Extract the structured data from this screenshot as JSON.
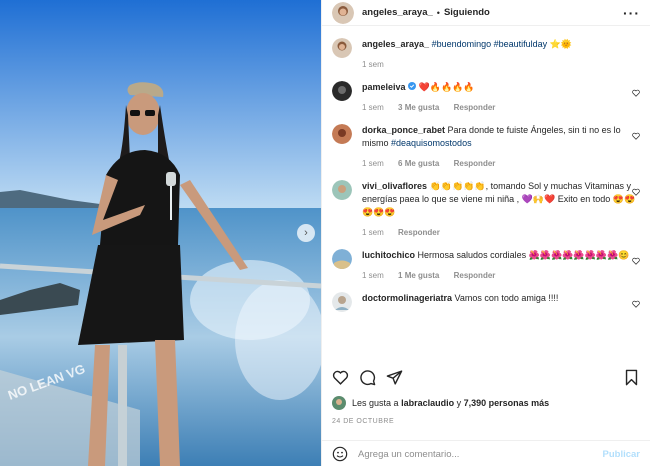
{
  "header": {
    "username": "angeles_araya_",
    "separator": "•",
    "follow_label": "Siguiendo",
    "more_icon": "more-icon"
  },
  "caption": {
    "username": "angeles_araya_",
    "text": "#buendomingo #beautifulday ⭐🌞",
    "time": "1 sem"
  },
  "comments": [
    {
      "username": "pameleiva",
      "verified": true,
      "text": "❤️🔥🔥🔥🔥",
      "time": "1 sem",
      "likes": "3 Me gusta",
      "reply": "Responder"
    },
    {
      "username": "dorka_ponce_rabet",
      "verified": false,
      "text": "Para donde te fuiste Ángeles, sin ti no es lo mismo",
      "tag": "#deaquisomostodos",
      "time": "1 sem",
      "likes": "6 Me gusta",
      "reply": "Responder"
    },
    {
      "username": "vivi_olivaflores",
      "verified": false,
      "text": "👏👏👏👏👏, tomando Sol y muchas Vitaminas y energías paea lo que se viene mi niña , 💜🙌❤️ Exito en todo 😍😍😍😍😍",
      "time": "1 sem",
      "likes": "",
      "reply": "Responder"
    },
    {
      "username": "luchitochico",
      "verified": false,
      "text": "Hermosa saludos cordiales 🌺🌺🌺🌺🌺🌺🌺🌺😊",
      "time": "1 sem",
      "likes": "1 Me gusta",
      "reply": "Responder"
    },
    {
      "username": "doctormolinageriatra",
      "verified": false,
      "text": "Vamos con todo amiga !!!!",
      "time": "",
      "likes": "",
      "reply": ""
    }
  ],
  "likes": {
    "prefix": "Les gusta a",
    "user": "labraclaudio",
    "conj": "y",
    "count": "7,390 personas más"
  },
  "date": "24 DE OCTUBRE",
  "add_comment": {
    "placeholder": "Agrega un comentario...",
    "publish": "Publicar"
  },
  "photo_caption": "NO LEAN VG",
  "colors": {
    "link": "#00376b",
    "muted": "#8e8e8e",
    "publish": "#b2dffc",
    "verified": "#3897f0"
  }
}
